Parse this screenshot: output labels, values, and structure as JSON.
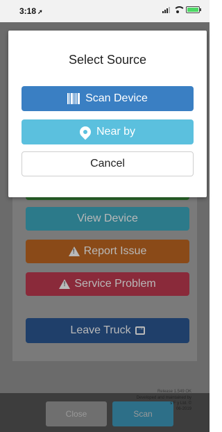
{
  "status_bar": {
    "time": "3:18",
    "location_arrow": "➚",
    "icons": [
      "signal-icon",
      "wifi-icon",
      "battery-icon"
    ]
  },
  "modal": {
    "title": "Select Source",
    "buttons": [
      {
        "label": "Scan Device",
        "icon": "barcode-icon",
        "color": "#3a7fc3"
      },
      {
        "label": "Near by",
        "icon": "location-pin-icon",
        "color": "#5bc0de"
      },
      {
        "label": "Cancel",
        "color": "#ffffff"
      }
    ]
  },
  "background_page": {
    "buttons": [
      {
        "label": "View Device",
        "color": "#2c7a8a"
      },
      {
        "label": "Report Issue",
        "icon": "warning-icon",
        "color": "#8a4a18"
      },
      {
        "label": "Service Problem",
        "icon": "warning-icon",
        "color": "#8a2a3a"
      },
      {
        "label": "Leave Truck",
        "icon": "exit-icon",
        "color": "#1f3f6a"
      }
    ],
    "release": "Release 1.549 OK",
    "developed_by": "Developed and maintained by",
    "company_partial": "s F                  y Ltd. ©",
    "years_partial": "06-2019"
  },
  "bottom_bar": {
    "close_label": "Close",
    "scan_label": "Scan"
  }
}
